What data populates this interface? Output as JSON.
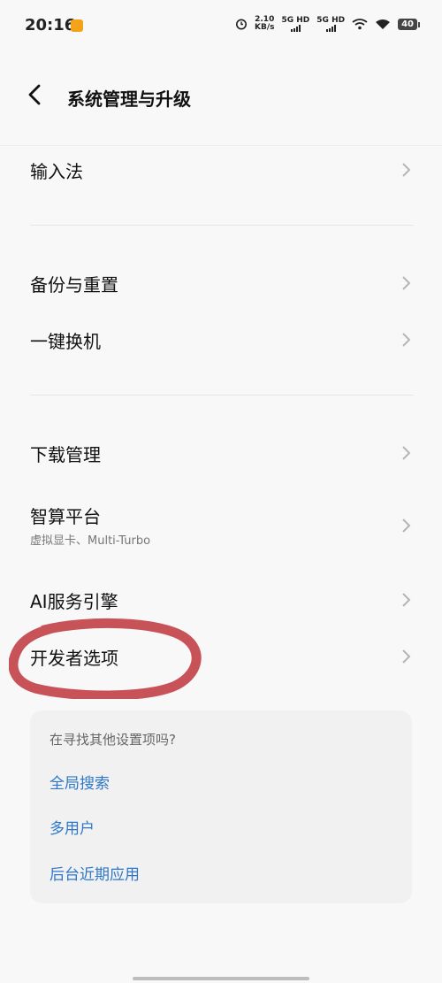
{
  "status_bar": {
    "time": "20:16",
    "speed_value": "2.10",
    "speed_unit": "KB/s",
    "sim1_label": "5G HD",
    "sim2_label": "5G HD",
    "battery": "40"
  },
  "header": {
    "title": "系统管理与升级"
  },
  "menu": {
    "input_method": "输入法",
    "backup_reset": "备份与重置",
    "phone_clone": "一键换机",
    "download_manager": "下载管理",
    "compute_platform": "智算平台",
    "compute_platform_sub": "虚拟显卡、Multi-Turbo",
    "ai_engine": "AI服务引擎",
    "developer_options": "开发者选项"
  },
  "suggestions": {
    "prompt": "在寻找其他设置项吗?",
    "links": [
      "全局搜索",
      "多用户",
      "后台近期应用"
    ]
  },
  "colors": {
    "link": "#2f77c8",
    "annotation": "#c2444a"
  }
}
